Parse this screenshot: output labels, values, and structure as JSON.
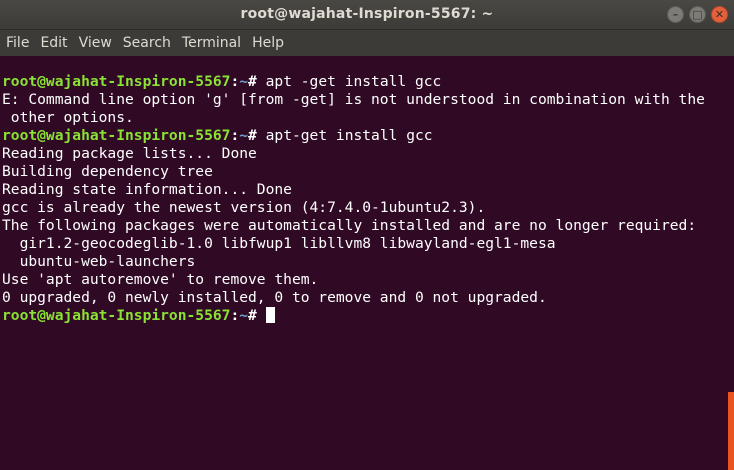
{
  "window": {
    "title": "root@wajahat-Inspiron-5567: ~",
    "controls": {
      "minimize_glyph": "–",
      "maximize_glyph": "□",
      "close_glyph": "✕"
    }
  },
  "menu": [
    "File",
    "Edit",
    "View",
    "Search",
    "Terminal",
    "Help"
  ],
  "prompt": {
    "user_host": "root@wajahat-Inspiron-5567",
    "colon": ":",
    "path": "~",
    "sign": "# "
  },
  "terminal": {
    "cmd1": "apt -get install gcc",
    "out1a": "E: Command line option 'g' [from -get] is not understood in combination with the",
    "out1b": " other options.",
    "cmd2": "apt-get install gcc",
    "out2": [
      "Reading package lists... Done",
      "Building dependency tree",
      "Reading state information... Done",
      "gcc is already the newest version (4:7.4.0-1ubuntu2.3).",
      "The following packages were automatically installed and are no longer required:",
      "  gir1.2-geocodeglib-1.0 libfwup1 libllvm8 libwayland-egl1-mesa",
      "  ubuntu-web-launchers",
      "Use 'apt autoremove' to remove them.",
      "0 upgraded, 0 newly installed, 0 to remove and 0 not upgraded."
    ]
  },
  "colors": {
    "background": "#300a24",
    "prompt_user": "#8ae234",
    "prompt_path": "#729fcf",
    "scrollbar_thumb": "#e95420"
  }
}
